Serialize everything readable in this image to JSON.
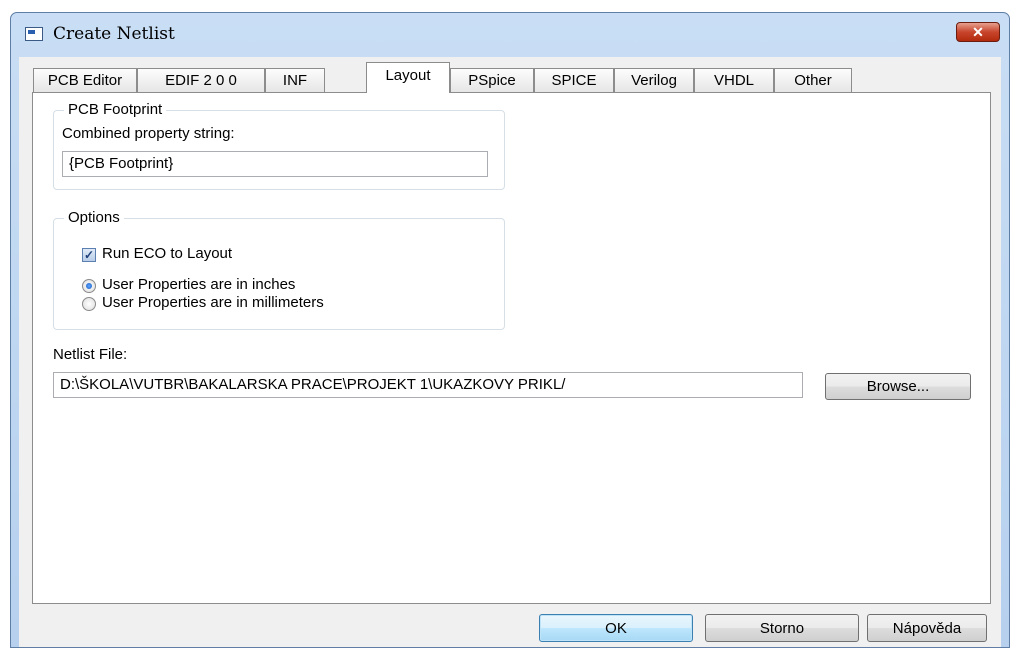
{
  "window": {
    "title": "Create Netlist",
    "close_icon": "close-icon"
  },
  "tabs": [
    {
      "label": "PCB Editor"
    },
    {
      "label": "EDIF 2 0 0"
    },
    {
      "label": "INF"
    },
    {
      "label": "Layout",
      "active": true
    },
    {
      "label": "PSpice"
    },
    {
      "label": "SPICE"
    },
    {
      "label": "Verilog"
    },
    {
      "label": "VHDL"
    },
    {
      "label": "Other"
    }
  ],
  "pcb_footprint": {
    "legend": "PCB Footprint",
    "label": "Combined property string:",
    "value": "{PCB Footprint}"
  },
  "options": {
    "legend": "Options",
    "run_eco_label": "Run ECO to Layout",
    "run_eco_checked": true,
    "inches_label": "User Properties are in inches",
    "millimeters_label": "User Properties are in millimeters",
    "selected_unit": "inches"
  },
  "netlist": {
    "label": "Netlist File:",
    "value": "D:\\ŠKOLA\\VUTBR\\BAKALARSKA PRACE\\PROJEKT 1\\UKAZKOVY PRIKL/",
    "browse_label": "Browse..."
  },
  "buttons": {
    "ok": "OK",
    "cancel": "Storno",
    "help": "Nápověda"
  },
  "colors": {
    "title_bar": "#c9def4",
    "close_button": "#c8452c",
    "default_button": "#3c7fb1"
  }
}
